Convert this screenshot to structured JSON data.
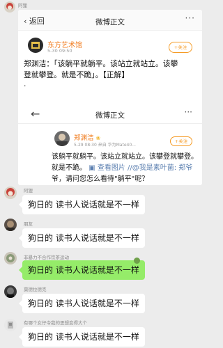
{
  "top_user": {
    "name": "阿狸"
  },
  "card": {
    "nav": {
      "back_label": "返回",
      "title": "微博正文",
      "more": "···"
    },
    "post": {
      "author": "东方艺术馆",
      "time": "5-30 09:50",
      "follow_label": "+关注",
      "lines": [
        "郑渊洁：「该躺平就躺平。该站立就站立。该攀",
        "登就攀登。就是不跪」。【正解】"
      ],
      "dot": "·"
    },
    "inner": {
      "nav_title": "微博正文",
      "more": "···",
      "author": "郑渊洁",
      "meta": "5-29 08:30  来自 华为Mate40...",
      "follow_label": "+关注",
      "lines": [
        "该躺平就躺平。该站立就站立。该攀登就攀登。",
        "就是不跪。"
      ],
      "line2_tail": "查看图片 //@我是素叶菌: 郑爷",
      "line3": "爷，请问您怎么看待\"躺平\"呢？"
    }
  },
  "chat": [
    {
      "name": "阿狸",
      "text": "狗日的 读书人说话就是不一样",
      "green": false
    },
    {
      "name": "朋友",
      "text": "狗日的 读书人说话就是不一样",
      "green": false
    },
    {
      "name": "非暴力不合作饮茶运动",
      "text": "狗日的 读书人说话就是不一样",
      "green": true
    },
    {
      "name": "莫德拉德克",
      "text": "狗日的 读书人说话就是不一样",
      "green": false
    },
    {
      "name": "有哪个女仔令我的思想变得大个",
      "text": "狗日的 读书人说话就是不一样",
      "green": false
    }
  ]
}
